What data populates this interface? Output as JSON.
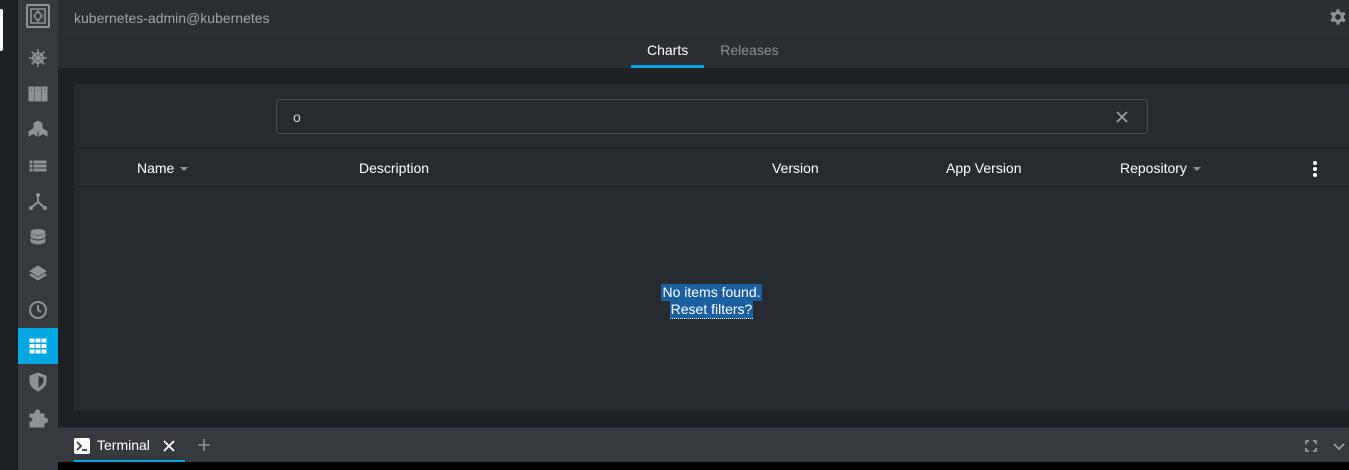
{
  "header": {
    "context": "kubernetes-admin@kubernetes",
    "settings_icon": "gear-icon"
  },
  "tabs": [
    {
      "label": "Charts",
      "active": true
    },
    {
      "label": "Releases",
      "active": false
    }
  ],
  "sidebar": {
    "items": [
      {
        "icon": "helm-wheel-icon"
      },
      {
        "icon": "nodes-icon"
      },
      {
        "icon": "workloads-icon"
      },
      {
        "icon": "config-list-icon"
      },
      {
        "icon": "network-icon"
      },
      {
        "icon": "storage-icon"
      },
      {
        "icon": "namespaces-layers-icon"
      },
      {
        "icon": "events-clock-icon"
      },
      {
        "icon": "apps-grid-icon",
        "active": true
      },
      {
        "icon": "access-control-shield-icon"
      },
      {
        "icon": "extensions-puzzle-icon"
      }
    ]
  },
  "search": {
    "value": "o",
    "placeholder": ""
  },
  "table": {
    "columns": [
      {
        "label": "Name",
        "sortable": true
      },
      {
        "label": "Description",
        "sortable": false
      },
      {
        "label": "Version",
        "sortable": false
      },
      {
        "label": "App Version",
        "sortable": false
      },
      {
        "label": "Repository",
        "sortable": true
      }
    ]
  },
  "empty": {
    "message": "No items found.",
    "reset": "Reset filters?"
  },
  "dock": {
    "tab_label": "Terminal"
  },
  "colors": {
    "accent": "#00a7e1",
    "sidebar": "#36393e",
    "panel": "#262b2f"
  }
}
